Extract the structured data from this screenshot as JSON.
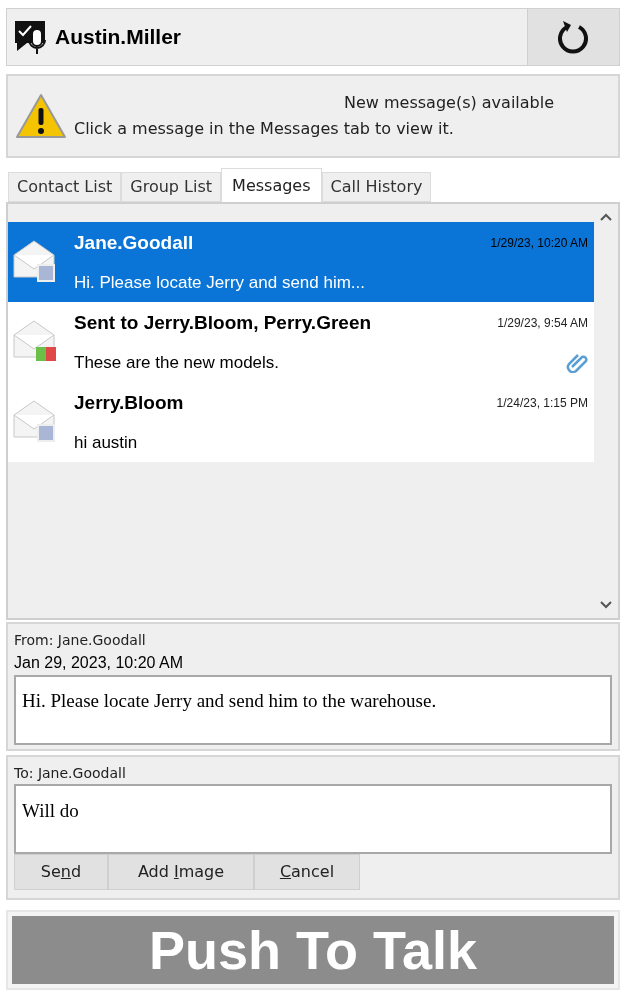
{
  "header": {
    "user": "Austin.Miller"
  },
  "notice": {
    "title": "New message(s) available",
    "text": "Click a message in the Messages tab to view it."
  },
  "tabs": [
    {
      "label": "Contact List",
      "selected": false
    },
    {
      "label": "Group List",
      "selected": false
    },
    {
      "label": "Messages",
      "selected": true
    },
    {
      "label": "Call History",
      "selected": false
    }
  ],
  "messages": [
    {
      "kind": "received",
      "sender": "Jane.Goodall",
      "time": "1/29/23, 10:20 AM",
      "preview": "Hi. Please locate Jerry and send him...",
      "selected": true,
      "attachment": false
    },
    {
      "kind": "sent",
      "sender": "Sent to Jerry.Bloom, Perry.Green",
      "time": "1/29/23, 9:54 AM",
      "preview": "These are the new models.",
      "selected": false,
      "attachment": true
    },
    {
      "kind": "received",
      "sender": "Jerry.Bloom",
      "time": "1/24/23, 1:15 PM",
      "preview": "hi austin",
      "selected": false,
      "attachment": false
    }
  ],
  "detail": {
    "from": "From: Jane.Goodall",
    "date": "Jan 29, 2023, 10:20 AM",
    "body": "Hi. Please locate Jerry and send him to the warehouse."
  },
  "reply": {
    "to": "To: Jane.Goodall",
    "value": "Will do"
  },
  "buttons": [
    {
      "label_before": "Se",
      "mnemonic": "n",
      "label_after": "d"
    },
    {
      "label_before": "Add ",
      "mnemonic": "I",
      "label_after": "mage"
    },
    {
      "mnemonic": "C",
      "label_after": "ancel"
    }
  ],
  "push_to_talk": {
    "label": "Push To Talk"
  }
}
